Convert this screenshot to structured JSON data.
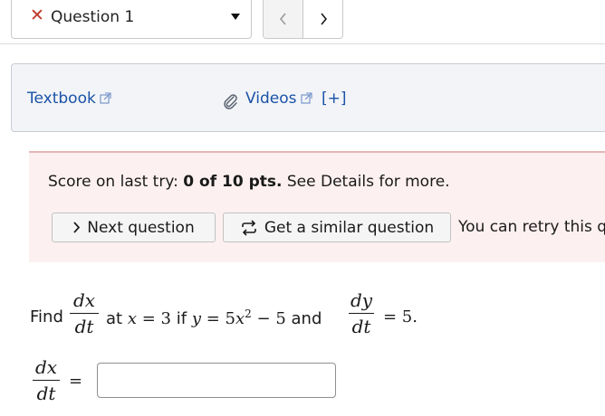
{
  "question_nav": {
    "selected": "Question 1",
    "status_icon": "x-mark-icon",
    "prev_icon": "chevron-left-icon",
    "next_icon": "chevron-right-icon"
  },
  "resources": {
    "textbook_label": "Textbook",
    "videos_label": "Videos",
    "expand_label": "[+]"
  },
  "score": {
    "prefix": "Score on last try:",
    "value": "0 of 10 pts.",
    "suffix": "See Details for more.",
    "next_button": "Next question",
    "similar_button": "Get a similar question",
    "retry_text": "You can retry this q"
  },
  "problem": {
    "find": "Find",
    "dx": "dx",
    "dt": "dt",
    "at": "at",
    "x_var": "x",
    "eq": "=",
    "x_val": "3",
    "if": "if",
    "y_var": "y",
    "coef": "5",
    "x2": "x",
    "exp": "2",
    "minus_const": "− 5",
    "and": "and",
    "dy": "dy",
    "rhs": "= 5."
  },
  "answer": {
    "lhs_num": "dx",
    "lhs_den": "dt",
    "equals": "=",
    "value": ""
  },
  "colors": {
    "link": "#1b52a8",
    "error_mark": "#c0392b",
    "score_bg": "#fdf0f0",
    "resource_bg": "#f2f4f7"
  }
}
